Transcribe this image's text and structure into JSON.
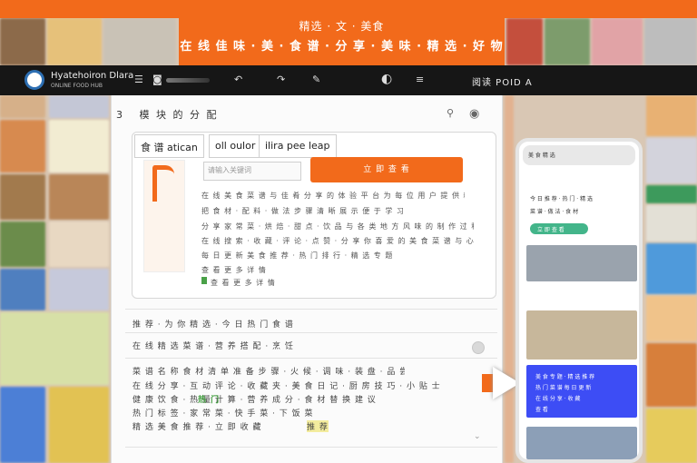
{
  "banner": {
    "line1": "精选 · 文 · 美食",
    "line2": "在 线 佳 味 · 美 · 食 谱 · 分 享 · 美 味 · 精 选 · 好 物"
  },
  "topbar": {
    "brand": "Hyatehoiron Dlara",
    "brand_sub": "ONLINE FOOD HUB",
    "icons": [
      "menu-icon",
      "camera-icon",
      "back-icon",
      "forward-icon",
      "tag-icon",
      "planet-icon",
      "list-icon"
    ],
    "right_text": "阅读 POID A"
  },
  "crumbs": {
    "step": "3",
    "text": "模 块 的 分 配"
  },
  "card": {
    "tab1": "食 谱 atican",
    "tab2": "oll oulor",
    "tab3": "ilira pee leap",
    "search_placeholder": "请输入关键词",
    "cta": "立 即 查 看",
    "lines": [
      "在 线 美 食 菜 谱 与 佳 肴 分 享 的 体 验 平 台 为 每 位 用 户 提 供 精 选 内 容",
      "把 食 材 · 配 料 · 做 法 步 骤 清 晰 展 示 便 于 学 习",
      "分 享 家 常 菜 · 烘 焙 · 甜 点 · 饮 品 与 各 类 地 方 风 味 的 制 作 过 程",
      "在 线 搜 索 · 收 藏 · 评 论 · 点 赞 · 分 享 你 喜 爱 的 美 食 菜 谱 与 心 得",
      "每 日 更 新 美 食 推 荐 · 热 门 排 行 · 精 选 专 题",
      "查 看 更 多 详 情"
    ]
  },
  "section": {
    "heading": "推 荐 · 为 你 精 选 · 今 日 热 门 食 谱",
    "subheading": "在 线 精 选 菜 谱 · 营 养 搭 配 · 烹 饪 技 巧",
    "rows": [
      "菜 谱 名 称 食 材 清 单 准 备 步 骤 · 火 候 · 调 味 · 装 盘 · 品 尝",
      "在 线 分 享 · 互 动 评 论 · 收 藏 夹 · 美 食 日 记 · 厨 房 技 巧 · 小 贴 士",
      "健 康 饮 食 · 热 量 计 算 · 营 养 成 分 · 食 材 替 换 建 议",
      "热 门 标 签 · 家 常 菜 · 快 手 菜 · 下 饭 菜 · 甜 品",
      "精 选 美 食 推 荐 · 立 即 收 藏"
    ],
    "highlight_green": "热 门",
    "highlight_yellow": "推 荐"
  },
  "phone": {
    "header": "美 食 精 选",
    "row1": "今 日 推 荐 · 热 门 · 精 选",
    "row2": "菜 谱 · 做 法 · 食 材",
    "green_label": "立 即 查 看",
    "blue_lines": [
      "美 食 专 题 · 精 选 推 荐",
      "热 门 菜 谱 每 日 更 新",
      "在 线 分 享 · 收 藏"
    ],
    "blue_button": "查 看"
  },
  "colors": {
    "accent": "#f26a1b",
    "topbar": "#161616",
    "blue": "#3d4df5",
    "green": "#43b58a"
  }
}
